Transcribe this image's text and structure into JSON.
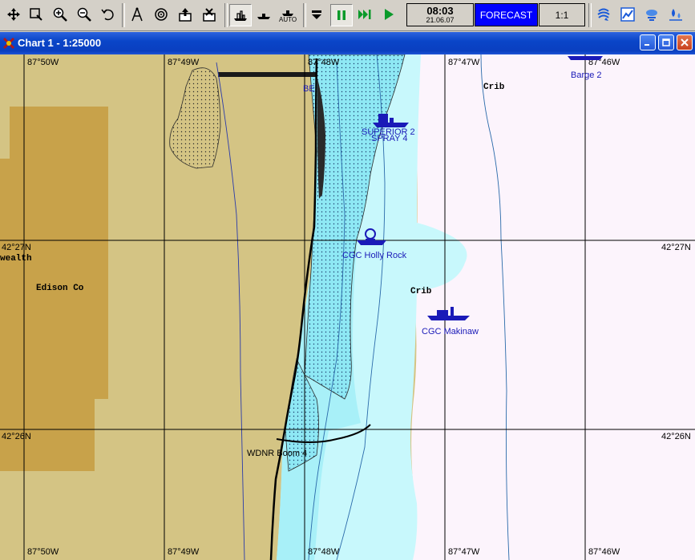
{
  "toolbar": {
    "clock_time": "08:03",
    "clock_date": "21.06.07",
    "forecast_label": "FORECAST",
    "scale_label": "1:1",
    "auto_label": "AUTO",
    "icons": [
      "move-icon",
      "select-icon",
      "zoom-in-icon",
      "zoom-out-icon",
      "undo-icon",
      "compass-icon",
      "target-icon",
      "export-icon",
      "import-icon",
      "ship-mode-icon",
      "ship-small-icon",
      "auto-ship-icon",
      "stop-icon",
      "pause-icon",
      "fast-forward-icon",
      "play-icon",
      "weather-icon",
      "chart-icon",
      "cloud-icon",
      "water-icon"
    ]
  },
  "window": {
    "title": "Chart 1 - 1:25000"
  },
  "map": {
    "lon_labels_top": [
      "87°50W",
      "87°49W",
      "87°48W",
      "87°47W",
      "87°46W"
    ],
    "lon_labels_bottom": [
      "87°50W",
      "87°49W",
      "87°48W",
      "87°47W",
      "87°46W"
    ],
    "lat_labels": [
      "42°27N",
      "42°26N"
    ],
    "place_labels": [
      "wealth",
      "Edison Co",
      "Crib",
      "Crib"
    ],
    "vessel_labels": [
      "Barge 2",
      "SUPERIOR 2",
      "SPRAY 4",
      "CGC Holly Rock",
      "CGC Makinaw",
      "WDNR Boom 4",
      "BE"
    ],
    "colors": {
      "land": "#d4c484",
      "land_dark": "#c8a24a",
      "shallow": "#a8f0f8",
      "mid": "#c8f8fc",
      "deep": "#fcf4fc",
      "vessel": "#1a1ab8"
    }
  }
}
